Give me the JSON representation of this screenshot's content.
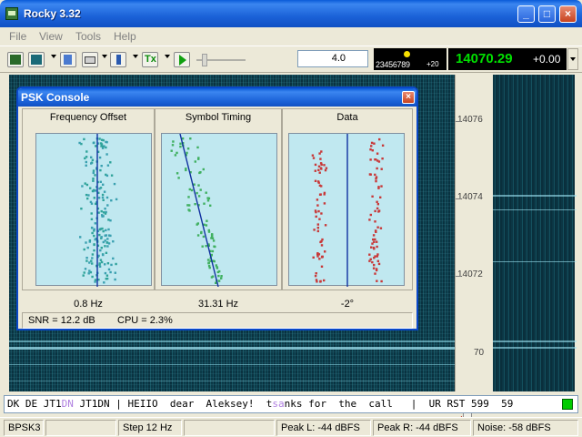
{
  "app": {
    "title": "Rocky 3.32"
  },
  "menu": [
    "File",
    "View",
    "Tools",
    "Help"
  ],
  "toolbar": {
    "speed_value": "4.0",
    "digits": "23456789",
    "digits_sub": "+20",
    "frequency": "14070.29",
    "offset": "+0.00"
  },
  "scale": {
    "labels": [
      "14076",
      "14074",
      "14072",
      "70"
    ]
  },
  "console": {
    "title": "PSK Console",
    "panels": [
      {
        "heading": "Frequency Offset",
        "value": "0.8 Hz"
      },
      {
        "heading": "Symbol Timing",
        "value": "31.31 Hz"
      },
      {
        "heading": "Data",
        "value": "-2°"
      }
    ],
    "snr": "SNR = 12.2 dB",
    "cpu": "CPU = 2.3%"
  },
  "rx": {
    "part1": "DK DE JT1",
    "part2": "DN",
    "part3": " JT1DN | HEIIO  dear  Aleksey!  t",
    "part4": "sa",
    "part5": "nk",
    "part6": "s for  the  call   |  UR RST 599  59"
  },
  "status": {
    "mode": "BPSK3",
    "step": "Step 12 Hz",
    "peak_l": "Peak L: -44 dBFS",
    "peak_r": "Peak R: -44 dBFS",
    "noise": "Noise: -58 dBFS"
  },
  "colors": {
    "title_blue": "#0a5bd8",
    "freq_green": "#00e000",
    "scatter_green": "#40b060",
    "scatter_teal": "#2fa39a",
    "scatter_red": "#c83838",
    "line_blue": "#1030a0"
  }
}
